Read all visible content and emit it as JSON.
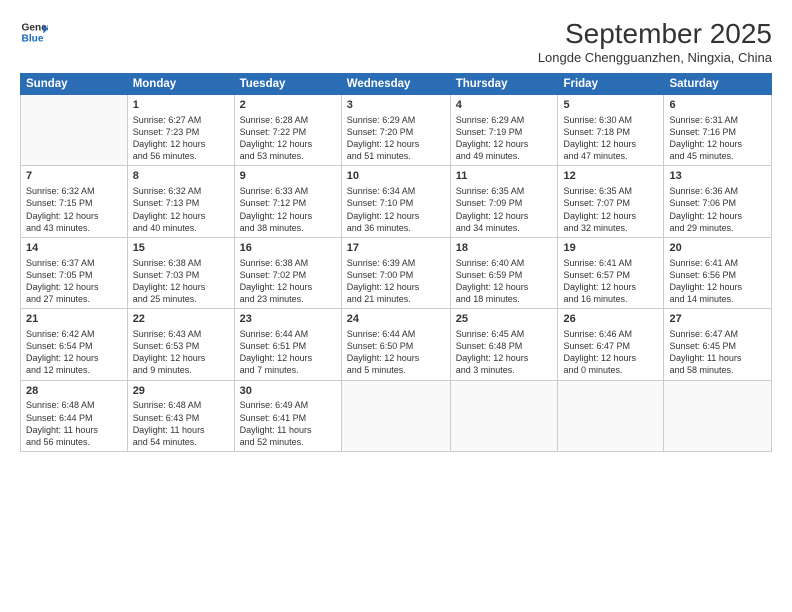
{
  "header": {
    "logo_line1": "General",
    "logo_line2": "Blue",
    "month": "September 2025",
    "location": "Longde Chengguanzhen, Ningxia, China"
  },
  "days_of_week": [
    "Sunday",
    "Monday",
    "Tuesday",
    "Wednesday",
    "Thursday",
    "Friday",
    "Saturday"
  ],
  "weeks": [
    [
      {
        "day": "",
        "data": ""
      },
      {
        "day": "1",
        "data": "Sunrise: 6:27 AM\nSunset: 7:23 PM\nDaylight: 12 hours\nand 56 minutes."
      },
      {
        "day": "2",
        "data": "Sunrise: 6:28 AM\nSunset: 7:22 PM\nDaylight: 12 hours\nand 53 minutes."
      },
      {
        "day": "3",
        "data": "Sunrise: 6:29 AM\nSunset: 7:20 PM\nDaylight: 12 hours\nand 51 minutes."
      },
      {
        "day": "4",
        "data": "Sunrise: 6:29 AM\nSunset: 7:19 PM\nDaylight: 12 hours\nand 49 minutes."
      },
      {
        "day": "5",
        "data": "Sunrise: 6:30 AM\nSunset: 7:18 PM\nDaylight: 12 hours\nand 47 minutes."
      },
      {
        "day": "6",
        "data": "Sunrise: 6:31 AM\nSunset: 7:16 PM\nDaylight: 12 hours\nand 45 minutes."
      }
    ],
    [
      {
        "day": "7",
        "data": "Sunrise: 6:32 AM\nSunset: 7:15 PM\nDaylight: 12 hours\nand 43 minutes."
      },
      {
        "day": "8",
        "data": "Sunrise: 6:32 AM\nSunset: 7:13 PM\nDaylight: 12 hours\nand 40 minutes."
      },
      {
        "day": "9",
        "data": "Sunrise: 6:33 AM\nSunset: 7:12 PM\nDaylight: 12 hours\nand 38 minutes."
      },
      {
        "day": "10",
        "data": "Sunrise: 6:34 AM\nSunset: 7:10 PM\nDaylight: 12 hours\nand 36 minutes."
      },
      {
        "day": "11",
        "data": "Sunrise: 6:35 AM\nSunset: 7:09 PM\nDaylight: 12 hours\nand 34 minutes."
      },
      {
        "day": "12",
        "data": "Sunrise: 6:35 AM\nSunset: 7:07 PM\nDaylight: 12 hours\nand 32 minutes."
      },
      {
        "day": "13",
        "data": "Sunrise: 6:36 AM\nSunset: 7:06 PM\nDaylight: 12 hours\nand 29 minutes."
      }
    ],
    [
      {
        "day": "14",
        "data": "Sunrise: 6:37 AM\nSunset: 7:05 PM\nDaylight: 12 hours\nand 27 minutes."
      },
      {
        "day": "15",
        "data": "Sunrise: 6:38 AM\nSunset: 7:03 PM\nDaylight: 12 hours\nand 25 minutes."
      },
      {
        "day": "16",
        "data": "Sunrise: 6:38 AM\nSunset: 7:02 PM\nDaylight: 12 hours\nand 23 minutes."
      },
      {
        "day": "17",
        "data": "Sunrise: 6:39 AM\nSunset: 7:00 PM\nDaylight: 12 hours\nand 21 minutes."
      },
      {
        "day": "18",
        "data": "Sunrise: 6:40 AM\nSunset: 6:59 PM\nDaylight: 12 hours\nand 18 minutes."
      },
      {
        "day": "19",
        "data": "Sunrise: 6:41 AM\nSunset: 6:57 PM\nDaylight: 12 hours\nand 16 minutes."
      },
      {
        "day": "20",
        "data": "Sunrise: 6:41 AM\nSunset: 6:56 PM\nDaylight: 12 hours\nand 14 minutes."
      }
    ],
    [
      {
        "day": "21",
        "data": "Sunrise: 6:42 AM\nSunset: 6:54 PM\nDaylight: 12 hours\nand 12 minutes."
      },
      {
        "day": "22",
        "data": "Sunrise: 6:43 AM\nSunset: 6:53 PM\nDaylight: 12 hours\nand 9 minutes."
      },
      {
        "day": "23",
        "data": "Sunrise: 6:44 AM\nSunset: 6:51 PM\nDaylight: 12 hours\nand 7 minutes."
      },
      {
        "day": "24",
        "data": "Sunrise: 6:44 AM\nSunset: 6:50 PM\nDaylight: 12 hours\nand 5 minutes."
      },
      {
        "day": "25",
        "data": "Sunrise: 6:45 AM\nSunset: 6:48 PM\nDaylight: 12 hours\nand 3 minutes."
      },
      {
        "day": "26",
        "data": "Sunrise: 6:46 AM\nSunset: 6:47 PM\nDaylight: 12 hours\nand 0 minutes."
      },
      {
        "day": "27",
        "data": "Sunrise: 6:47 AM\nSunset: 6:45 PM\nDaylight: 11 hours\nand 58 minutes."
      }
    ],
    [
      {
        "day": "28",
        "data": "Sunrise: 6:48 AM\nSunset: 6:44 PM\nDaylight: 11 hours\nand 56 minutes."
      },
      {
        "day": "29",
        "data": "Sunrise: 6:48 AM\nSunset: 6:43 PM\nDaylight: 11 hours\nand 54 minutes."
      },
      {
        "day": "30",
        "data": "Sunrise: 6:49 AM\nSunset: 6:41 PM\nDaylight: 11 hours\nand 52 minutes."
      },
      {
        "day": "",
        "data": ""
      },
      {
        "day": "",
        "data": ""
      },
      {
        "day": "",
        "data": ""
      },
      {
        "day": "",
        "data": ""
      }
    ]
  ]
}
